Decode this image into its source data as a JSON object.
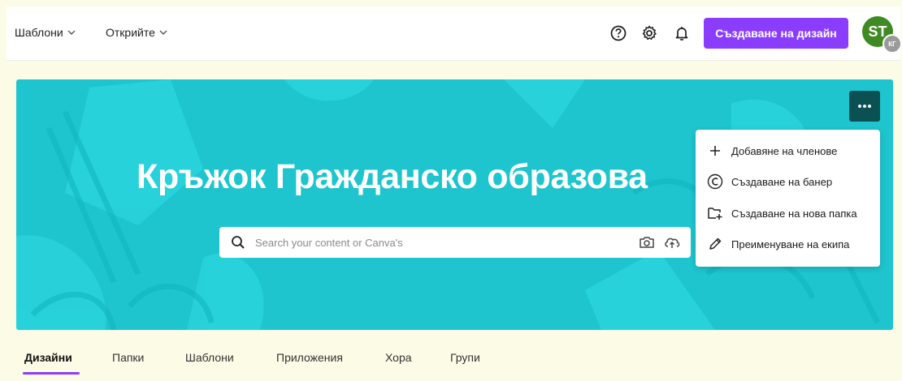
{
  "header": {
    "nav": [
      {
        "label": "Шаблони"
      },
      {
        "label": "Открийте"
      }
    ],
    "create_button": "Създаване на дизайн",
    "avatar_initials": "ST",
    "avatar_badge": "КГ",
    "icons": [
      "help-icon",
      "gear-icon",
      "bell-icon"
    ]
  },
  "banner": {
    "title": "Кръжок Гражданско образова",
    "search_placeholder": "Search your content or Canva's",
    "color": "#1ec5cf"
  },
  "menu": {
    "items": [
      {
        "label": "Добавяне на членове",
        "icon": "plus-icon"
      },
      {
        "label": "Създаване на банер",
        "icon": "canva-logo-icon"
      },
      {
        "label": "Създаване на нова папка",
        "icon": "new-folder-icon"
      },
      {
        "label": "Преименуване на екипа",
        "icon": "pencil-icon"
      }
    ]
  },
  "tabs": [
    {
      "label": "Дизайни",
      "active": true
    },
    {
      "label": "Папки"
    },
    {
      "label": "Шаблони"
    },
    {
      "label": "Приложения"
    },
    {
      "label": "Хора"
    },
    {
      "label": "Групи"
    }
  ],
  "colors": {
    "accent": "#8b3dff",
    "avatar": "#3f8a22",
    "more_button": "#0b5154"
  }
}
